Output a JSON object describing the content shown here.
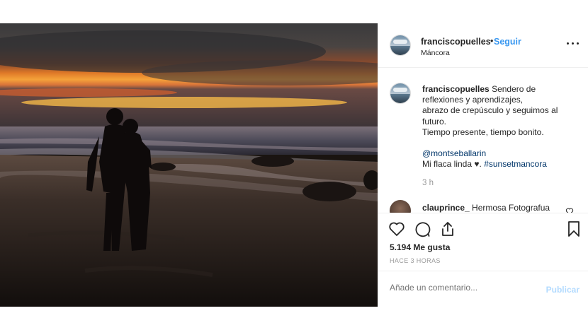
{
  "post": {
    "username": "franciscopuelles",
    "separator": "•",
    "follow_label": "Seguir",
    "location": "Máncora",
    "more_icon": "more-horizontal-icon"
  },
  "caption": {
    "username": "franciscopuelles",
    "lines": [
      "Sendero de",
      "reflexiones y aprendizajes,",
      "abrazo de crepúsculo y seguimos al",
      "futuro.",
      "Tiempo presente, tiempo bonito."
    ],
    "mention": "@montseballarin",
    "closing_text": "Mi flaca linda",
    "heart": "♥",
    "period": ".",
    "hashtag": "#sunsetmancora",
    "time": "3 h"
  },
  "comment": {
    "username": "clauprince_",
    "text": "Hermosa Fotografua"
  },
  "actions": {
    "icons": [
      "heart-icon",
      "comment-icon",
      "share-icon",
      "bookmark-icon"
    ],
    "likes": "5.194 Me gusta",
    "posted_ago": "HACE 3 HORAS"
  },
  "composer": {
    "placeholder": "Añade un comentario...",
    "publish_label": "Publicar"
  },
  "colors": {
    "link": "#3897f0",
    "mention": "#003569",
    "publish_disabled": "#b3dbff",
    "muted": "#999999"
  }
}
